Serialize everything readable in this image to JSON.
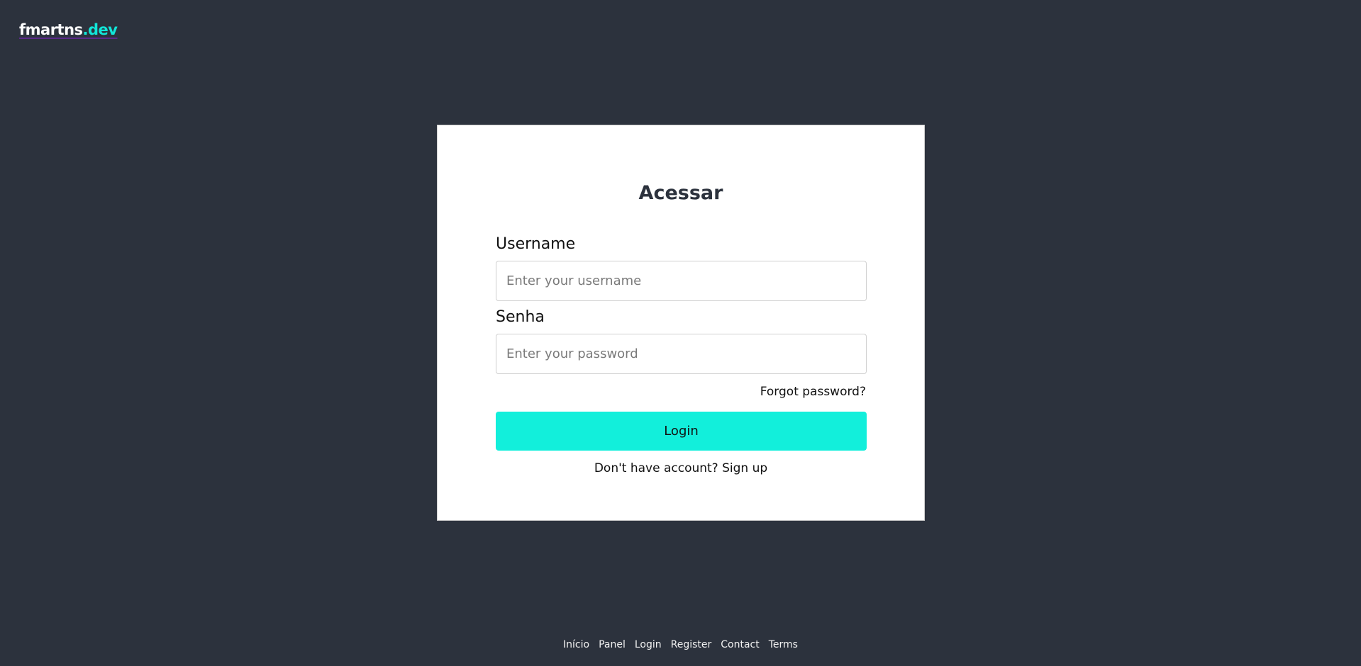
{
  "header": {
    "logo_main": "fmartns",
    "logo_accent": ".dev"
  },
  "login_form": {
    "title": "Acessar",
    "username_label": "Username",
    "username_placeholder": "Enter your username",
    "username_value": "",
    "password_label": "Senha",
    "password_placeholder": "Enter your password",
    "password_value": "",
    "forgot_password": "Forgot password?",
    "login_button": "Login",
    "signup_prompt": "Don't have account?",
    "signup_link": "Sign up"
  },
  "footer": {
    "links": [
      {
        "label": "Início"
      },
      {
        "label": "Panel"
      },
      {
        "label": "Login"
      },
      {
        "label": "Register"
      },
      {
        "label": "Contact"
      },
      {
        "label": "Terms"
      }
    ]
  },
  "colors": {
    "background": "#2c323d",
    "accent": "#12efdb",
    "card": "#ffffff"
  }
}
